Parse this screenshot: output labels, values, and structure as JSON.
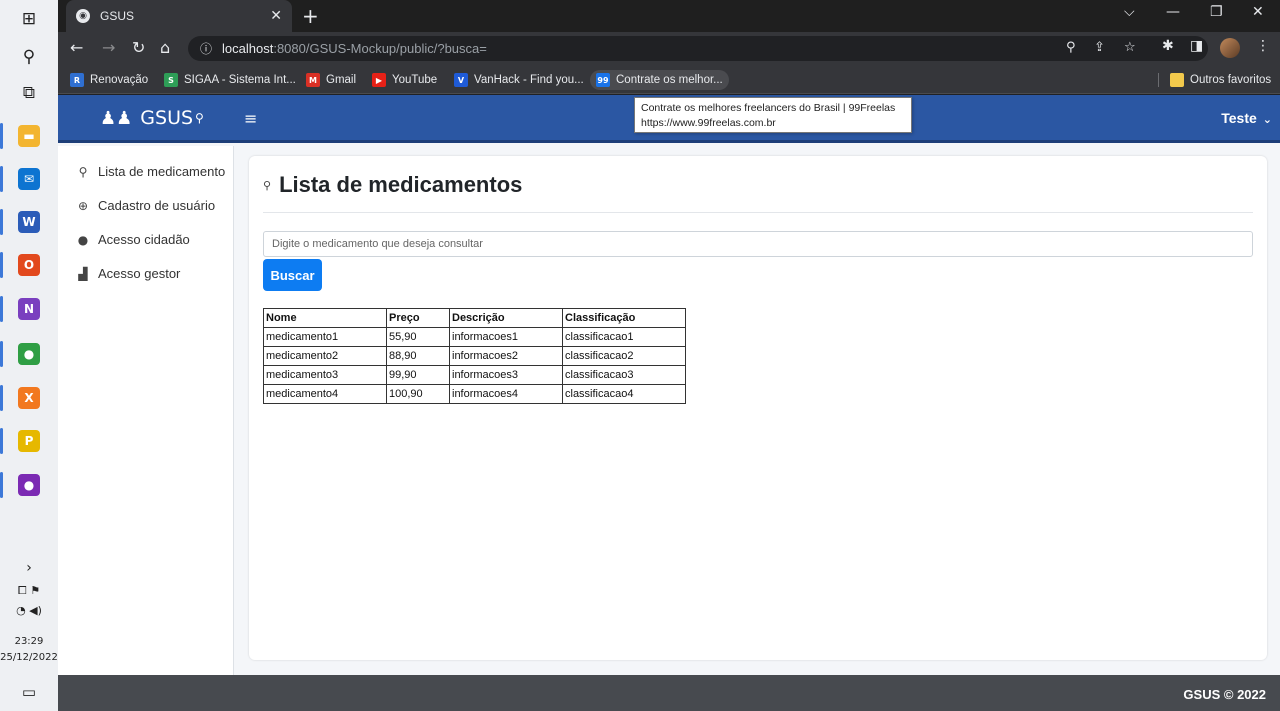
{
  "taskbar": {
    "clock_time": "23:29",
    "clock_date": "25/12/2022",
    "apps": [
      {
        "name": "explorer",
        "glyph": "▬",
        "color": "#f3b530"
      },
      {
        "name": "mail",
        "glyph": "✉",
        "color": "#0d74d1"
      },
      {
        "name": "word",
        "glyph": "W",
        "color": "#2b5cb8"
      },
      {
        "name": "office",
        "glyph": "O",
        "color": "#e2491d"
      },
      {
        "name": "onenote",
        "glyph": "N",
        "color": "#7a3fbf"
      },
      {
        "name": "chrome",
        "glyph": "●",
        "color": "#2f9e44"
      },
      {
        "name": "xampp",
        "glyph": "X",
        "color": "#f2781f"
      },
      {
        "name": "pdf",
        "glyph": "P",
        "color": "#e6b800"
      },
      {
        "name": "github",
        "glyph": "●",
        "color": "#7b2ab3"
      }
    ]
  },
  "browser": {
    "tab_title": "GSUS",
    "url_host": "localhost",
    "url_rest": ":8080/GSUS-Mockup/public/?busca=",
    "bookmarks": [
      {
        "label": "Renovação",
        "color": "#2f6fd1",
        "glyph": "R"
      },
      {
        "label": "SIGAA - Sistema Int...",
        "color": "#2e9e57",
        "glyph": "S"
      },
      {
        "label": "Gmail",
        "color": "#d93025",
        "glyph": "M"
      },
      {
        "label": "YouTube",
        "color": "#e62117",
        "glyph": "▶"
      },
      {
        "label": "VanHack - Find you...",
        "color": "#1f5bd7",
        "glyph": "V"
      },
      {
        "label": "Contrate os melhor...",
        "color": "#1a73e8",
        "glyph": "99"
      }
    ],
    "other_bookmarks": "Outros favoritos",
    "tooltip": {
      "title": "Contrate os melhores freelancers do Brasil | 99Freelas",
      "url": "https://www.99freelas.com.br"
    }
  },
  "app": {
    "brand": "GSUS",
    "user": "Teste",
    "sidebar": [
      {
        "label": "Lista de medicamento",
        "icon": "search-icon",
        "glyph": "⚲"
      },
      {
        "label": "Cadastro de usuário",
        "icon": "plus-circle-icon",
        "glyph": "⊕"
      },
      {
        "label": "Acesso cidadão",
        "icon": "user-icon",
        "glyph": "●"
      },
      {
        "label": "Acesso gestor",
        "icon": "chart-icon",
        "glyph": "▟"
      }
    ],
    "page_title": "Lista de medicamentos",
    "search_placeholder": "Digite o medicamento que deseja consultar",
    "search_button": "Buscar",
    "table": {
      "headers": [
        "Nome",
        "Preço",
        "Descrição",
        "Classificação"
      ],
      "rows": [
        [
          "medicamento1",
          "55,90",
          "informacoes1",
          "classificacao1"
        ],
        [
          "medicamento2",
          "88,90",
          "informacoes2",
          "classificacao2"
        ],
        [
          "medicamento3",
          "99,90",
          "informacoes3",
          "classificacao3"
        ],
        [
          "medicamento4",
          "100,90",
          "informacoes4",
          "classificacao4"
        ]
      ]
    },
    "footer": "GSUS © 2022"
  }
}
